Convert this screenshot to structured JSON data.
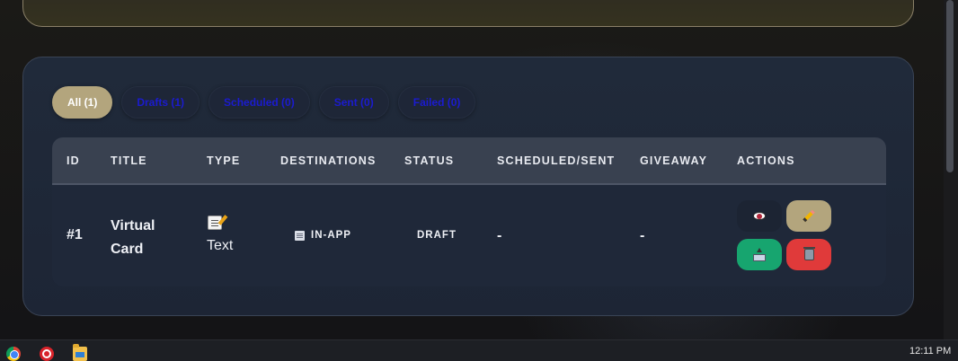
{
  "filters": [
    {
      "label": "All (1)",
      "active": true
    },
    {
      "label": "Drafts (1)",
      "active": false
    },
    {
      "label": "Scheduled (0)",
      "active": false
    },
    {
      "label": "Sent (0)",
      "active": false
    },
    {
      "label": "Failed (0)",
      "active": false
    }
  ],
  "table": {
    "columns": [
      "ID",
      "TITLE",
      "TYPE",
      "DESTINATIONS",
      "STATUS",
      "SCHEDULED/SENT",
      "GIVEAWAY",
      "ACTIONS"
    ],
    "rows": [
      {
        "id": "#1",
        "title": "Virtual Card",
        "type_icon": "memo-icon",
        "type": "Text",
        "destination_icon": "newspaper-icon",
        "destination": "IN-APP",
        "status": "DRAFT",
        "scheduled_sent": "-",
        "giveaway": "-",
        "actions": [
          {
            "name": "view",
            "icon": "eye-icon"
          },
          {
            "name": "edit",
            "icon": "pencil-icon"
          },
          {
            "name": "send",
            "icon": "outbox-icon"
          },
          {
            "name": "delete",
            "icon": "trash-icon"
          }
        ]
      }
    ]
  },
  "taskbar": {
    "apps": [
      "chrome-icon",
      "target-icon",
      "folder-icon"
    ],
    "clock": "12:11 PM"
  },
  "colors": {
    "accent_gold": "#b3a57d",
    "filter_text": "#1b1bd0",
    "send_green": "#17a56f",
    "delete_red": "#e03a3a",
    "card_bg": "#202a3a"
  }
}
